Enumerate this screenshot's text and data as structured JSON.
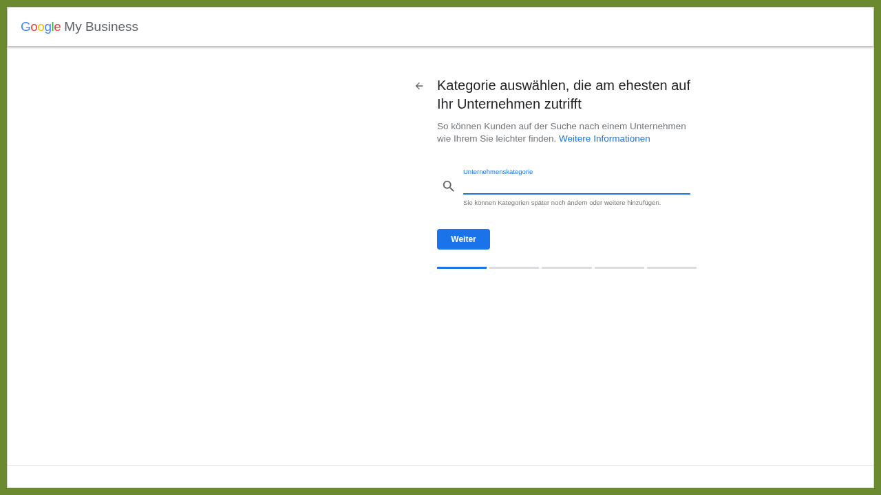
{
  "header": {
    "logo_text": "Google",
    "product": "My Business"
  },
  "heading": "Kategorie auswählen, die am ehesten auf Ihr Unternehmen zutrifft",
  "description": "So können Kunden auf der Suche nach einem Unternehmen wie Ihrem Sie leichter finden.",
  "link": "Weitere Informationen",
  "field": {
    "label": "Unternehmenskategorie",
    "focused": true,
    "helper": "Sie können Kategorien später noch ändern oder weitere hinzufügen."
  },
  "button": "Weiter",
  "steps": [
    {
      "complete": true
    },
    {
      "complete": false
    },
    {
      "complete": false
    },
    {
      "complete": false
    },
    {
      "complete": false
    }
  ]
}
